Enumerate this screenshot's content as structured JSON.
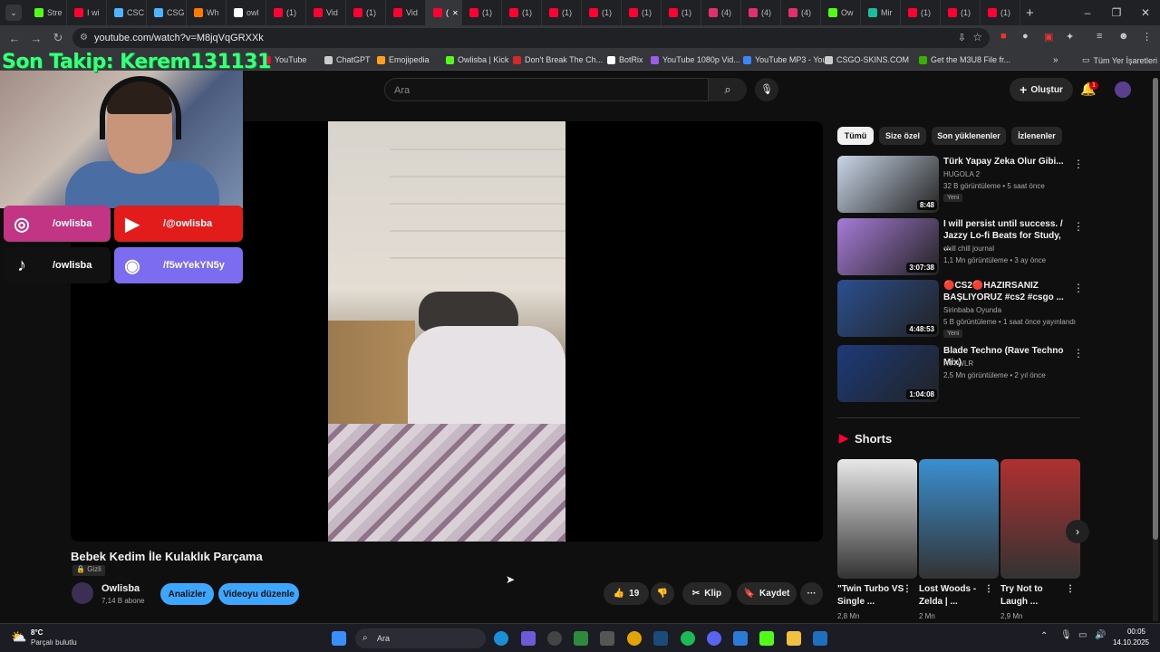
{
  "browser": {
    "tabs": [
      {
        "label": "Stre",
        "color": "#53fc18"
      },
      {
        "label": "I wi",
        "color": "#ff0033"
      },
      {
        "label": "CSC",
        "color": "#4fb3ff"
      },
      {
        "label": "CSG",
        "color": "#4fb3ff"
      },
      {
        "label": "Wh",
        "color": "#ff7a00"
      },
      {
        "label": "owl",
        "color": "#ffffff"
      },
      {
        "label": "(1)",
        "color": "#ff0033"
      },
      {
        "label": "Vid",
        "color": "#ff0033"
      },
      {
        "label": "(1)",
        "color": "#ff0033"
      },
      {
        "label": "Vid",
        "color": "#ff0033"
      },
      {
        "label": "(",
        "color": "#ff0033",
        "active": true
      },
      {
        "label": "(1)",
        "color": "#ff0033"
      },
      {
        "label": "(1)",
        "color": "#ff0033"
      },
      {
        "label": "(1)",
        "color": "#ff0033"
      },
      {
        "label": "(1)",
        "color": "#ff0033"
      },
      {
        "label": "(1)",
        "color": "#ff0033"
      },
      {
        "label": "(1)",
        "color": "#ff0033"
      },
      {
        "label": "(4)",
        "color": "#e1306c"
      },
      {
        "label": "(4)",
        "color": "#e1306c"
      },
      {
        "label": "(4)",
        "color": "#e1306c"
      },
      {
        "label": "Ow",
        "color": "#53fc18"
      },
      {
        "label": "Mir",
        "color": "#1abc9c"
      },
      {
        "label": "(1)",
        "color": "#ff0033"
      },
      {
        "label": "(1)",
        "color": "#ff0033"
      },
      {
        "label": "(1)",
        "color": "#ff0033"
      }
    ],
    "url": "youtube.com/watch?v=M8jqVqGRXXk",
    "bookmarks": [
      {
        "label": "YouTube",
        "color": "#ff0033"
      },
      {
        "label": "ChatGPT",
        "color": "#cccccc"
      },
      {
        "label": "Emojipedia",
        "color": "#ff9f1c"
      },
      {
        "label": "Owlisba | Kick",
        "color": "#53fc18"
      },
      {
        "label": "Don't Break The Ch...",
        "color": "#d62828"
      },
      {
        "label": "BotRix",
        "color": "#ffffff"
      },
      {
        "label": "YouTube 1080p Vid...",
        "color": "#9b5de5"
      },
      {
        "label": "YouTube MP3 - You...",
        "color": "#3a86ff"
      },
      {
        "label": "CSGO-SKINS.COM",
        "color": "#cccccc"
      },
      {
        "label": "Get the M3U8 File fr...",
        "color": "#38b000"
      }
    ],
    "all_bookmarks": "Tüm Yer İşaretleri"
  },
  "overlay": {
    "follow_text": "Son Takip: Kerem131131",
    "socials": [
      {
        "platform": "instagram-icon",
        "handle": "/owlisba",
        "color": "#c13584"
      },
      {
        "platform": "youtube-icon",
        "handle": "/@owlisba",
        "color": "#e21b1b"
      },
      {
        "platform": "tiktok-icon",
        "handle": "/owlisba",
        "color": "#111111"
      },
      {
        "platform": "discord-icon",
        "handle": "/f5wYekYN5y",
        "color": "#7b6cf0"
      }
    ]
  },
  "youtube": {
    "search_placeholder": "Ara",
    "create_label": "Oluştur",
    "notification_count": "1",
    "video": {
      "title": "Bebek Kedim İle Kulaklık Parçama",
      "privacy": "Gizli",
      "channel": "Owlisba",
      "subscribers": "7,14 B abone",
      "analytics_label": "Analizler",
      "edit_label": "Videoyu düzenle",
      "likes": "19",
      "clip_label": "Klip",
      "save_label": "Kaydet"
    },
    "chips": [
      "Tümü",
      "Size özel",
      "Son yüklenenler",
      "İzlenenler"
    ],
    "recommendations": [
      {
        "title": "Türk Yapay Zeka Olur Gibi...",
        "channel": "HUGOLA 2",
        "meta": "32 B görüntüleme • 5 saat önce",
        "badge": "Yeni",
        "duration": "8:48",
        "thumb_color": "#c9d6e8"
      },
      {
        "title": "I will persist until success. / Jazzy Lo-fi Beats for Study, ...",
        "channel": "chill chill journal",
        "meta": "1,1 Mn görüntüleme • 3 ay önce",
        "badge": "",
        "duration": "3:07:38",
        "thumb_color": "#a77bd8"
      },
      {
        "title": "🔴CS2🔴HAZIRSANIZ BAŞLIYORUZ #cs2 #csgo ...",
        "channel": "Sirinbaba Oyunda",
        "meta": "5 B görüntüleme • 1 saat önce yayınlandı",
        "badge": "Yeni",
        "duration": "4:48:53",
        "thumb_color": "#2b4f8f"
      },
      {
        "title": "Blade Techno (Rave Techno Mix)",
        "channel": "RTTWLR",
        "meta": "2,5 Mn görüntüleme • 2 yıl önce",
        "badge": "",
        "duration": "1:04:08",
        "thumb_color": "#1d3a7a"
      }
    ],
    "shorts_heading": "Shorts",
    "shorts": [
      {
        "title": "\"Twin Turbo VS Single ...",
        "views": "2,8 Mn",
        "thumb_color": "#e8e8e8"
      },
      {
        "title": "Lost Woods - Zelda | ...",
        "views": "2 Mn",
        "thumb_color": "#3a8fd0"
      },
      {
        "title": "Try Not to Laugh ...",
        "views": "2,9 Mn",
        "thumb_color": "#b03030"
      }
    ]
  },
  "taskbar": {
    "weather_temp": "8°C",
    "weather_desc": "Parçalı bulutlu",
    "search_label": "Ara",
    "time": "00:05",
    "date": "14.10.2025"
  }
}
